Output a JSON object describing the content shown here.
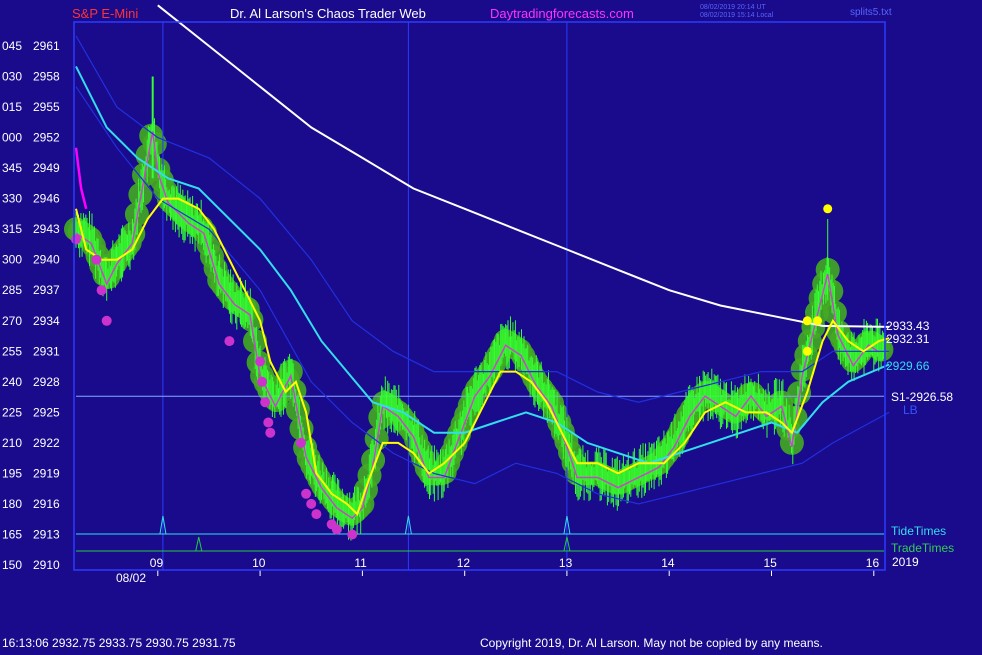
{
  "header": {
    "symbol": "S&P E-Mini",
    "title": "Dr. Al Larson's Chaos Trader Web",
    "site": "Daytradingforecasts.com",
    "utc_stamp": "08/02/2019 20:14 UT",
    "local_stamp": "08/02/2019 15:14 Local",
    "file": "splits5.txt"
  },
  "footer": {
    "quote": "16:13:06  2932.75 2933.75 2930.75 2931.75",
    "copyright": "Copyright 2019, Dr. Al Larson. May not be copied by any means."
  },
  "colors": {
    "background": "#1a0a8c",
    "frame": "#2a3cff",
    "price_bars": "#33ff33",
    "ema_fast": "#ffff00",
    "ema_mid": "#33ddee",
    "ema_slow": "#ffffff",
    "bands": "#2030e0",
    "dots": "#cc33cc",
    "glow": "#44aa22",
    "tide": "#33ddee",
    "trade": "#22cc44"
  },
  "chart_data": {
    "type": "line",
    "date_label": "08/02",
    "year_label": "2019",
    "x_ticks": [
      "09",
      "10",
      "11",
      "12",
      "13",
      "14",
      "15",
      "16"
    ],
    "x_range": [
      8.2,
      16.1
    ],
    "y_range": [
      2910,
      2964
    ],
    "y_ticks": [
      {
        "angle": "045",
        "price": "2961",
        "v": 2961
      },
      {
        "angle": "030",
        "price": "2958",
        "v": 2958
      },
      {
        "angle": "015",
        "price": "2955",
        "v": 2955
      },
      {
        "angle": "000",
        "price": "2952",
        "v": 2952
      },
      {
        "angle": "345",
        "price": "2949",
        "v": 2949
      },
      {
        "angle": "330",
        "price": "2946",
        "v": 2946
      },
      {
        "angle": "315",
        "price": "2943",
        "v": 2943
      },
      {
        "angle": "300",
        "price": "2940",
        "v": 2940
      },
      {
        "angle": "285",
        "price": "2937",
        "v": 2937
      },
      {
        "angle": "270",
        "price": "2934",
        "v": 2934
      },
      {
        "angle": "255",
        "price": "2931",
        "v": 2931
      },
      {
        "angle": "240",
        "price": "2928",
        "v": 2928
      },
      {
        "angle": "225",
        "price": "2925",
        "v": 2925
      },
      {
        "angle": "210",
        "price": "2922",
        "v": 2922
      },
      {
        "angle": "195",
        "price": "2919",
        "v": 2919
      },
      {
        "angle": "180",
        "price": "2916",
        "v": 2916
      },
      {
        "angle": "165",
        "price": "2913",
        "v": 2913
      },
      {
        "angle": "150",
        "price": "2910",
        "v": 2910
      }
    ],
    "price": [
      [
        8.2,
        2943
      ],
      [
        8.35,
        2942
      ],
      [
        8.5,
        2938
      ],
      [
        8.6,
        2940
      ],
      [
        8.75,
        2942
      ],
      [
        8.95,
        2953
      ],
      [
        9.0,
        2949
      ],
      [
        9.1,
        2946
      ],
      [
        9.3,
        2944
      ],
      [
        9.45,
        2943
      ],
      [
        9.6,
        2938
      ],
      [
        9.75,
        2936
      ],
      [
        9.9,
        2935
      ],
      [
        10.0,
        2929
      ],
      [
        10.15,
        2926
      ],
      [
        10.3,
        2929
      ],
      [
        10.45,
        2921
      ],
      [
        10.6,
        2918
      ],
      [
        10.75,
        2916
      ],
      [
        10.9,
        2915
      ],
      [
        11.0,
        2916
      ],
      [
        11.1,
        2920
      ],
      [
        11.2,
        2926
      ],
      [
        11.35,
        2925
      ],
      [
        11.5,
        2923
      ],
      [
        11.65,
        2919
      ],
      [
        11.8,
        2919
      ],
      [
        11.95,
        2923
      ],
      [
        12.1,
        2927
      ],
      [
        12.25,
        2929
      ],
      [
        12.4,
        2932
      ],
      [
        12.55,
        2931
      ],
      [
        12.7,
        2928
      ],
      [
        12.85,
        2926
      ],
      [
        13.0,
        2922
      ],
      [
        13.1,
        2919
      ],
      [
        13.3,
        2919
      ],
      [
        13.5,
        2918
      ],
      [
        13.7,
        2919
      ],
      [
        13.9,
        2920
      ],
      [
        14.05,
        2922
      ],
      [
        14.2,
        2925
      ],
      [
        14.35,
        2927
      ],
      [
        14.5,
        2926
      ],
      [
        14.65,
        2925
      ],
      [
        14.8,
        2927
      ],
      [
        14.95,
        2925
      ],
      [
        15.1,
        2926
      ],
      [
        15.2,
        2922
      ],
      [
        15.3,
        2929
      ],
      [
        15.45,
        2935
      ],
      [
        15.55,
        2939
      ],
      [
        15.65,
        2933
      ],
      [
        15.8,
        2930
      ],
      [
        15.95,
        2932
      ],
      [
        16.1,
        2931
      ]
    ],
    "series": [
      {
        "name": "",
        "key": "ema_fast",
        "values": [
          [
            8.2,
            2945
          ],
          [
            8.3,
            2941
          ],
          [
            8.45,
            2940
          ],
          [
            8.6,
            2940
          ],
          [
            8.75,
            2941
          ],
          [
            8.9,
            2944
          ],
          [
            9.05,
            2946
          ],
          [
            9.2,
            2946
          ],
          [
            9.4,
            2945
          ],
          [
            9.55,
            2943
          ],
          [
            9.7,
            2940
          ],
          [
            9.85,
            2937
          ],
          [
            10.0,
            2934
          ],
          [
            10.1,
            2930
          ],
          [
            10.25,
            2927
          ],
          [
            10.35,
            2928
          ],
          [
            10.45,
            2925
          ],
          [
            10.55,
            2919
          ],
          [
            10.7,
            2917
          ],
          [
            10.85,
            2916
          ],
          [
            10.95,
            2915
          ],
          [
            11.05,
            2918
          ],
          [
            11.2,
            2922
          ],
          [
            11.35,
            2922
          ],
          [
            11.5,
            2921
          ],
          [
            11.65,
            2919
          ],
          [
            11.8,
            2920
          ],
          [
            12.0,
            2922
          ],
          [
            12.2,
            2926
          ],
          [
            12.35,
            2929
          ],
          [
            12.5,
            2929
          ],
          [
            12.65,
            2928
          ],
          [
            12.8,
            2926
          ],
          [
            12.95,
            2923
          ],
          [
            13.1,
            2920
          ],
          [
            13.3,
            2920
          ],
          [
            13.5,
            2919
          ],
          [
            13.7,
            2920
          ],
          [
            13.95,
            2920
          ],
          [
            14.15,
            2922
          ],
          [
            14.35,
            2925
          ],
          [
            14.55,
            2926
          ],
          [
            14.75,
            2925
          ],
          [
            14.95,
            2925
          ],
          [
            15.1,
            2924
          ],
          [
            15.2,
            2923
          ],
          [
            15.35,
            2927
          ],
          [
            15.5,
            2932
          ],
          [
            15.6,
            2934
          ],
          [
            15.75,
            2932
          ],
          [
            15.9,
            2931
          ],
          [
            16.05,
            2932
          ],
          [
            16.15,
            2932.3
          ]
        ]
      },
      {
        "name": "",
        "key": "ema_mid",
        "values": [
          [
            8.2,
            2959
          ],
          [
            8.5,
            2953
          ],
          [
            8.8,
            2950
          ],
          [
            9.1,
            2948
          ],
          [
            9.4,
            2947
          ],
          [
            9.7,
            2944
          ],
          [
            10.0,
            2941
          ],
          [
            10.3,
            2937
          ],
          [
            10.6,
            2932
          ],
          [
            10.85,
            2929
          ],
          [
            11.1,
            2926
          ],
          [
            11.4,
            2925
          ],
          [
            11.7,
            2923
          ],
          [
            12.0,
            2923
          ],
          [
            12.3,
            2924
          ],
          [
            12.6,
            2925
          ],
          [
            12.9,
            2924
          ],
          [
            13.2,
            2922
          ],
          [
            13.5,
            2921
          ],
          [
            13.8,
            2920
          ],
          [
            14.1,
            2921
          ],
          [
            14.4,
            2922
          ],
          [
            14.7,
            2923
          ],
          [
            15.0,
            2924
          ],
          [
            15.25,
            2923
          ],
          [
            15.5,
            2926
          ],
          [
            15.75,
            2928
          ],
          [
            16.15,
            2929.7
          ]
        ]
      },
      {
        "name": "",
        "key": "ema_slow",
        "values": [
          [
            9.0,
            2965
          ],
          [
            9.5,
            2961
          ],
          [
            10.0,
            2957
          ],
          [
            10.5,
            2953
          ],
          [
            11.0,
            2950
          ],
          [
            11.5,
            2947
          ],
          [
            12.0,
            2945
          ],
          [
            12.5,
            2943
          ],
          [
            13.0,
            2941
          ],
          [
            13.5,
            2939
          ],
          [
            14.0,
            2937
          ],
          [
            14.5,
            2935.5
          ],
          [
            15.0,
            2934.5
          ],
          [
            15.5,
            2933.5
          ],
          [
            16.15,
            2933.4
          ]
        ]
      },
      {
        "name": "",
        "key": "band_upper",
        "values": [
          [
            8.2,
            2962
          ],
          [
            8.6,
            2955
          ],
          [
            9.0,
            2952
          ],
          [
            9.5,
            2950
          ],
          [
            10.0,
            2946
          ],
          [
            10.5,
            2940
          ],
          [
            10.9,
            2934
          ],
          [
            11.3,
            2931
          ],
          [
            11.7,
            2929
          ],
          [
            12.1,
            2929
          ],
          [
            12.5,
            2929
          ],
          [
            12.9,
            2929
          ],
          [
            13.3,
            2927
          ],
          [
            13.7,
            2926
          ],
          [
            14.1,
            2927
          ],
          [
            14.5,
            2928
          ],
          [
            14.9,
            2929
          ],
          [
            15.3,
            2929
          ],
          [
            15.6,
            2931
          ],
          [
            16.15,
            2931
          ]
        ]
      },
      {
        "name": "",
        "key": "band_lower",
        "values": [
          [
            8.2,
            2957
          ],
          [
            8.6,
            2951
          ],
          [
            9.0,
            2946
          ],
          [
            9.5,
            2943
          ],
          [
            10.0,
            2937
          ],
          [
            10.5,
            2928
          ],
          [
            10.9,
            2924
          ],
          [
            11.3,
            2921
          ],
          [
            11.7,
            2919
          ],
          [
            12.1,
            2918
          ],
          [
            12.5,
            2920
          ],
          [
            12.9,
            2919
          ],
          [
            13.3,
            2917
          ],
          [
            13.7,
            2916
          ],
          [
            14.1,
            2917
          ],
          [
            14.5,
            2918
          ],
          [
            14.9,
            2919
          ],
          [
            15.3,
            2920
          ],
          [
            15.6,
            2922
          ],
          [
            16.15,
            2925
          ]
        ]
      }
    ],
    "dots": [
      [
        8.2,
        2942
      ],
      [
        8.4,
        2940
      ],
      [
        8.45,
        2937
      ],
      [
        8.5,
        2934
      ],
      [
        9.7,
        2932
      ],
      [
        10.0,
        2930
      ],
      [
        10.02,
        2928
      ],
      [
        10.05,
        2926
      ],
      [
        10.08,
        2924
      ],
      [
        10.1,
        2923
      ],
      [
        10.4,
        2922
      ],
      [
        10.45,
        2917
      ],
      [
        10.5,
        2916
      ],
      [
        10.55,
        2915
      ],
      [
        10.7,
        2914
      ],
      [
        10.75,
        2913.5
      ],
      [
        10.9,
        2913
      ]
    ],
    "yellow_dots": [
      [
        15.35,
        2931
      ],
      [
        15.35,
        2934
      ],
      [
        15.45,
        2934
      ],
      [
        15.55,
        2945
      ]
    ],
    "s1_value": 2926.58,
    "annotations": {
      "s1_label": "S1-2926.58",
      "lb_label": "LB",
      "last_slow": "2933.43",
      "last_fast": "2932.31",
      "last_mid": "2929.66",
      "tide_label": "TideTimes",
      "trade_label": "TradeTimes"
    },
    "tide_times": [
      9.05,
      11.45,
      13.0
    ],
    "trade_times": [
      9.4,
      13.0
    ]
  }
}
